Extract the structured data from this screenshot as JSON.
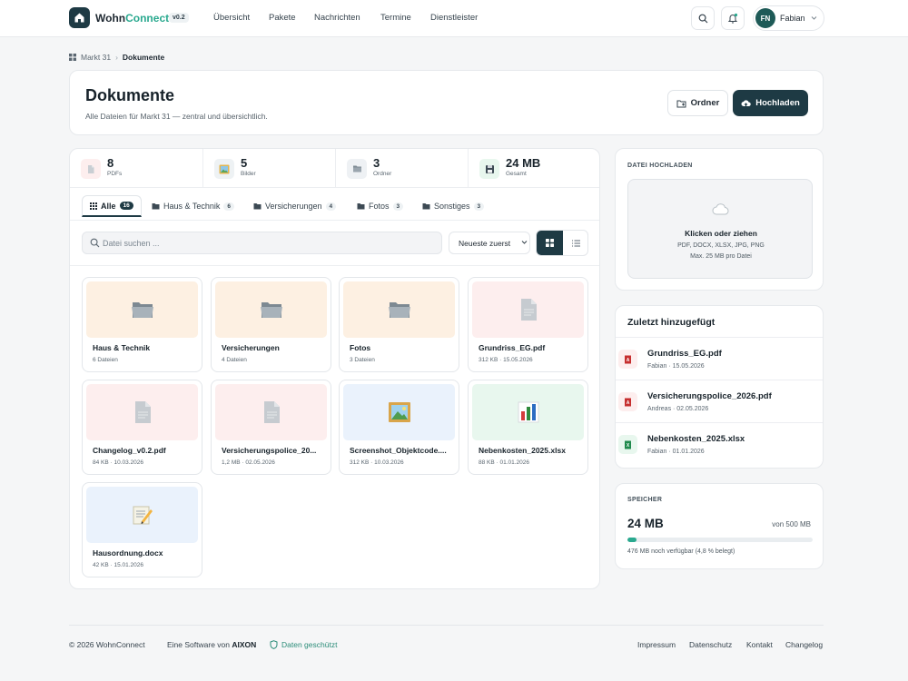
{
  "header": {
    "brand_main": "Wohn",
    "brand_accent": "Connect",
    "version": "v0.2",
    "nav": [
      "Übersicht",
      "Pakete",
      "Nachrichten",
      "Termine",
      "Dienstleister"
    ],
    "user_initials": "FN",
    "user_name": "Fabian"
  },
  "breadcrumb": {
    "root": "Markt 31",
    "current": "Dokumente"
  },
  "page": {
    "title": "Dokumente",
    "subtitle": "Alle Dateien für Markt 31 — zentral und übersichtlich.",
    "folder_button": "Ordner",
    "upload_button": "Hochladen"
  },
  "stats": [
    {
      "value": "8",
      "label": "PDFs",
      "icon": "pdf-icon"
    },
    {
      "value": "5",
      "label": "Bilder",
      "icon": "image-icon"
    },
    {
      "value": "3",
      "label": "Ordner",
      "icon": "folder-icon"
    },
    {
      "value": "24 MB",
      "label": "Gesamt",
      "icon": "disk-icon"
    }
  ],
  "tabs": [
    {
      "label": "Alle",
      "count": "16"
    },
    {
      "label": "Haus & Technik",
      "count": "6"
    },
    {
      "label": "Versicherungen",
      "count": "4"
    },
    {
      "label": "Fotos",
      "count": "3"
    },
    {
      "label": "Sonstiges",
      "count": "3"
    }
  ],
  "toolbar": {
    "search_placeholder": "Datei suchen ...",
    "sort_label": "Neueste zuerst"
  },
  "files": [
    {
      "name": "Haus & Technik",
      "meta": "6 Dateien",
      "kind": "folder"
    },
    {
      "name": "Versicherungen",
      "meta": "4 Dateien",
      "kind": "folder"
    },
    {
      "name": "Fotos",
      "meta": "3 Dateien",
      "kind": "folder"
    },
    {
      "name": "Grundriss_EG.pdf",
      "meta": "312 KB · 15.05.2026",
      "kind": "pdf"
    },
    {
      "name": "Changelog_v0.2.pdf",
      "meta": "84 KB · 10.03.2026",
      "kind": "pdf"
    },
    {
      "name": "Versicherungspolice_20...",
      "meta": "1,2 MB · 02.05.2026",
      "kind": "pdf"
    },
    {
      "name": "Screenshot_Objektcode....",
      "meta": "312 KB · 10.03.2026",
      "kind": "image"
    },
    {
      "name": "Nebenkosten_2025.xlsx",
      "meta": "88 KB · 01.01.2026",
      "kind": "xlsx"
    },
    {
      "name": "Hausordnung.docx",
      "meta": "42 KB · 15.01.2026",
      "kind": "docx"
    }
  ],
  "upload": {
    "section_label": "DATEI HOCHLADEN",
    "title": "Klicken oder ziehen",
    "formats": "PDF, DOCX, XLSX, JPG, PNG",
    "limit": "Max. 25 MB pro Datei"
  },
  "recent": {
    "title": "Zuletzt hinzugefügt",
    "items": [
      {
        "name": "Grundriss_EG.pdf",
        "meta": "Fabian · 15.05.2026",
        "kind": "pdf"
      },
      {
        "name": "Versicherungspolice_2026.pdf",
        "meta": "Andreas · 02.05.2026",
        "kind": "pdf"
      },
      {
        "name": "Nebenkosten_2025.xlsx",
        "meta": "Fabian · 01.01.2026",
        "kind": "xlsx"
      }
    ]
  },
  "storage": {
    "section_label": "SPEICHER",
    "used": "24 MB",
    "total": "von 500 MB",
    "note": "476 MB noch verfügbar (4,8 % belegt)",
    "used_fraction": 0.048
  },
  "footer": {
    "copyright": "© 2026 WohnConnect",
    "software_prefix": "Eine Software von",
    "software_company": "AIXON",
    "protected": "Daten geschützt",
    "links": [
      "Impressum",
      "Datenschutz",
      "Kontakt",
      "Changelog"
    ]
  },
  "colors": {
    "primary": "#1e3a44",
    "accent": "#2aa98f",
    "folder_bg": "#fdf0e2",
    "pdf_bg": "#fdeeee",
    "image_bg": "#eaf2fc",
    "xlsx_bg": "#e8f7ee"
  }
}
